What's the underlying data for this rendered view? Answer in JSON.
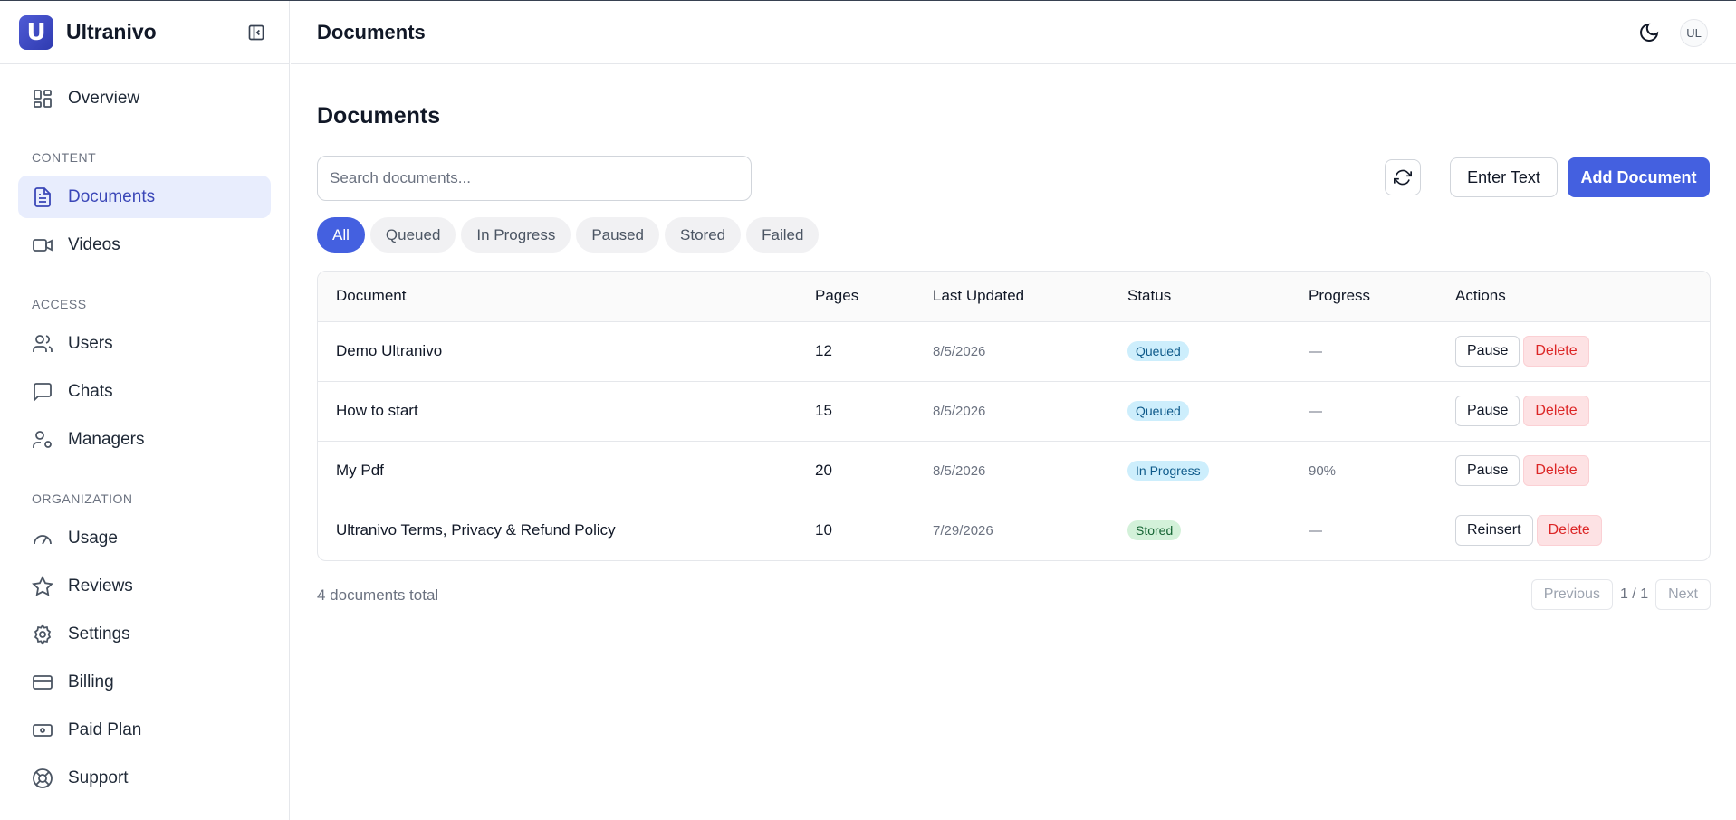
{
  "app": {
    "name": "Ultranivo",
    "logo_letter": "U"
  },
  "sidebar": {
    "overview": "Overview",
    "sections": [
      {
        "label": "CONTENT",
        "items": [
          "Documents",
          "Videos"
        ]
      },
      {
        "label": "ACCESS",
        "items": [
          "Users",
          "Chats",
          "Managers"
        ]
      },
      {
        "label": "ORGANIZATION",
        "items": [
          "Usage",
          "Reviews",
          "Settings",
          "Billing",
          "Paid Plan",
          "Support"
        ]
      }
    ],
    "active_item": "Documents"
  },
  "header": {
    "title": "Documents",
    "avatar_initials": "UL"
  },
  "main": {
    "title": "Documents",
    "search": {
      "placeholder": "Search documents...",
      "value": ""
    },
    "enter_text_label": "Enter Text",
    "add_document_label": "Add Document",
    "filters": [
      "All",
      "Queued",
      "In Progress",
      "Paused",
      "Stored",
      "Failed"
    ],
    "active_filter": "All",
    "table": {
      "columns": [
        "Document",
        "Pages",
        "Last Updated",
        "Status",
        "Progress",
        "Actions"
      ],
      "rows": [
        {
          "document": "Demo Ultranivo",
          "pages": "12",
          "updated": "8/5/2026",
          "status": "Queued",
          "progress": "—",
          "action1": "Pause",
          "action2": "Delete"
        },
        {
          "document": "How to start",
          "pages": "15",
          "updated": "8/5/2026",
          "status": "Queued",
          "progress": "—",
          "action1": "Pause",
          "action2": "Delete"
        },
        {
          "document": "My Pdf",
          "pages": "20",
          "updated": "8/5/2026",
          "status": "In Progress",
          "progress": "90%",
          "action1": "Pause",
          "action2": "Delete"
        },
        {
          "document": "Ultranivo Terms, Privacy & Refund Policy",
          "pages": "10",
          "updated": "7/29/2026",
          "status": "Stored",
          "progress": "—",
          "action1": "Reinsert",
          "action2": "Delete"
        }
      ]
    },
    "total_text": "4 documents total",
    "pagination": {
      "previous": "Previous",
      "page": "1 / 1",
      "next": "Next"
    }
  },
  "colors": {
    "accent": "#4460e0",
    "active_nav_bg": "#e8edfd",
    "queued_badge": "#cdeefc",
    "stored_badge": "#d3f1d9",
    "delete_bg": "#fde2e4"
  },
  "icons": {
    "overview": "grid-icon",
    "documents": "document-icon",
    "videos": "video-icon",
    "users": "users-icon",
    "chats": "chat-icon",
    "managers": "user-cog-icon",
    "usage": "gauge-icon",
    "reviews": "star-icon",
    "settings": "gear-icon",
    "billing": "credit-card-icon",
    "paid_plan": "banknote-icon",
    "support": "lifebuoy-icon"
  }
}
